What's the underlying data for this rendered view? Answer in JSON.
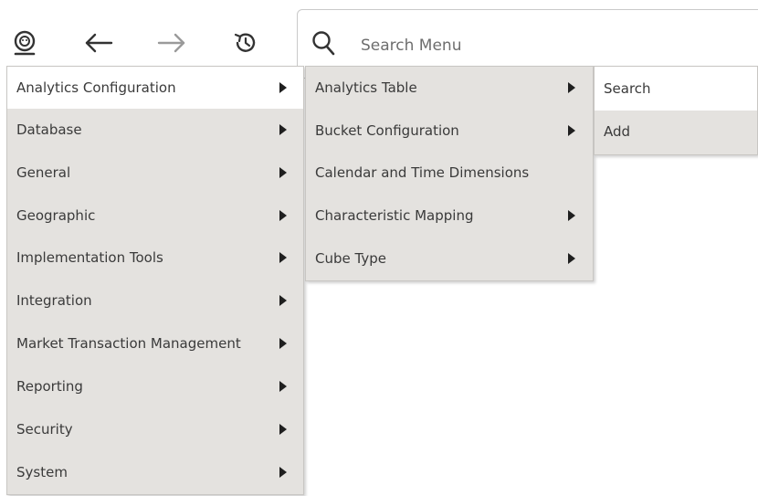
{
  "toolbar": {
    "user_icon": "user-avatar-icon",
    "back_icon": "arrow-left-icon",
    "forward_icon": "arrow-right-icon",
    "history_icon": "history-icon"
  },
  "search": {
    "icon": "search-icon",
    "placeholder": "Search Menu",
    "value": ""
  },
  "menu_level1": {
    "items": [
      {
        "label": "Analytics Configuration",
        "submenu": true,
        "active": true
      },
      {
        "label": "Database",
        "submenu": true
      },
      {
        "label": "General",
        "submenu": true
      },
      {
        "label": "Geographic",
        "submenu": true
      },
      {
        "label": "Implementation Tools",
        "submenu": true
      },
      {
        "label": "Integration",
        "submenu": true
      },
      {
        "label": "Market Transaction Management",
        "submenu": true
      },
      {
        "label": "Reporting",
        "submenu": true
      },
      {
        "label": "Security",
        "submenu": true
      },
      {
        "label": "System",
        "submenu": true
      }
    ]
  },
  "menu_level2": {
    "items": [
      {
        "label": "Analytics Table",
        "submenu": true
      },
      {
        "label": "Bucket Configuration",
        "submenu": true
      },
      {
        "label": "Calendar and Time Dimensions",
        "submenu": false
      },
      {
        "label": "Characteristic Mapping",
        "submenu": true
      },
      {
        "label": "Cube Type",
        "submenu": true
      }
    ]
  },
  "menu_level3": {
    "items": [
      {
        "label": "Search",
        "active": true
      },
      {
        "label": "Add"
      }
    ]
  },
  "colors": {
    "menu_bg": "#e4e2df",
    "active_bg": "#ffffff",
    "text": "#3a3a3a",
    "icon": "#333333"
  }
}
